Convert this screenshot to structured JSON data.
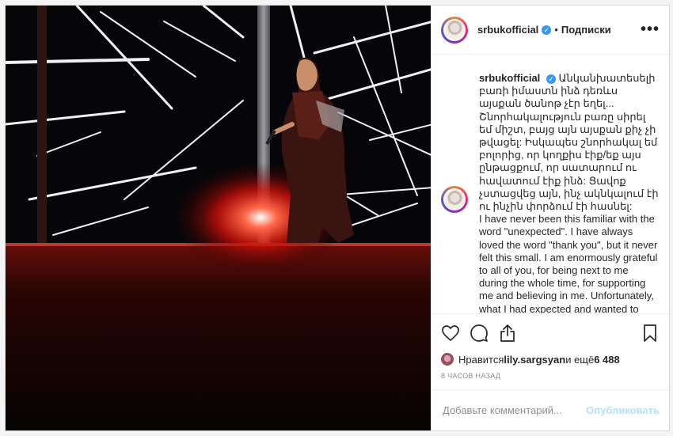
{
  "post": {
    "username": "srbukofficial",
    "follow_label": "Подписки",
    "more_label": "•••",
    "caption": {
      "username": "srbukofficial",
      "armenian": "Անկանխատեսելի բառի իմաստն ինձ դեռևս այսքան ծանոթ չէր եղել... Շնորհակալություն բառը սիրել եմ միշտ, բայց այն այսքան քիչ չի թվացել: Իսկապես շնորհակալ եմ բոլորից, որ կողքիս էիք/եք այս ընթացքում, որ սատարում ու հավատում էիք ինձ: Ցավոք չստացվեց այն, ինչ ակնկալում էի ու ինչին փորձում էի հասնել:",
      "english": "I have never been this familiar with the word \"unexpected\". I have always loved the word \"thank you\", but it never felt this small. I am enormously grateful to all of you, for being next to me during the whole time, for supporting me and believing in me. Unfortunately, what I had expected and wanted to achieve didn't happen."
    },
    "likes": {
      "prefix": "Нравится ",
      "user": "lily.sargsyan",
      "middle": " и ещё ",
      "count": "6 488"
    },
    "time_ago": "8 ЧАСОВ НАЗАД",
    "comment_placeholder": "Добавьте комментарий...",
    "publish_label": "Опубликовать"
  },
  "icons": {
    "like": "heart-icon",
    "comment": "comment-icon",
    "share": "share-icon",
    "save": "bookmark-icon",
    "verified": "verified-badge-icon"
  },
  "colors": {
    "verified": "#3897f0",
    "publish_disabled": "#b2dffc",
    "meta_text": "#8e8e8e",
    "spotlight": "#ff2a1a"
  }
}
